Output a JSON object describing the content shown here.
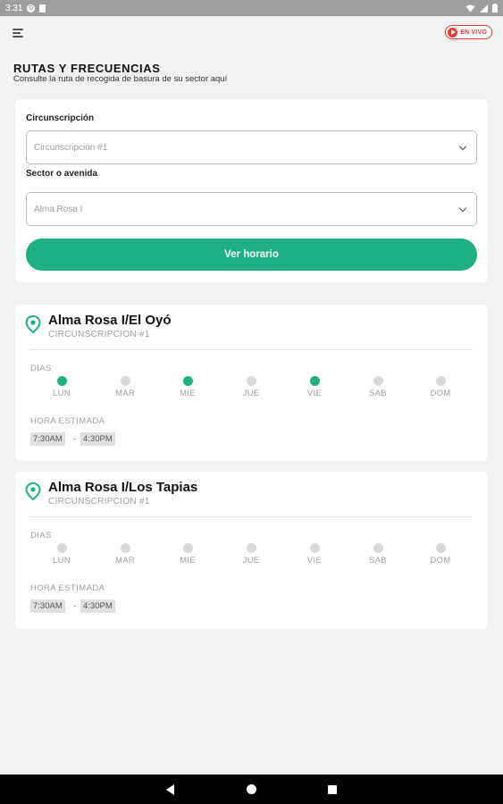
{
  "status_bar": {
    "time": "3:31",
    "icon_letter": "G"
  },
  "header": {
    "live_label": "EN VIVO"
  },
  "page": {
    "title": "RUTAS Y FRECUENCIAS",
    "subtitle": "Consulte la ruta de recogida de basura de su sector aquí"
  },
  "form": {
    "circ_label": "Circunscripción",
    "circ_value": "Circunscripción #1",
    "sector_label": "Sector o avenida",
    "sector_value": "Alma Rosa I",
    "button_label": "Ver horario"
  },
  "routes": [
    {
      "name": "Alma Rosa I/El Oyó",
      "circ": "CIRCUNSCRIPCION #1",
      "days_label": "DIAS",
      "days": [
        {
          "label": "LUN",
          "active": true
        },
        {
          "label": "MAR",
          "active": false
        },
        {
          "label": "MIE",
          "active": true
        },
        {
          "label": "JUE",
          "active": false
        },
        {
          "label": "VIE",
          "active": true
        },
        {
          "label": "SAB",
          "active": false
        },
        {
          "label": "DOM",
          "active": false
        }
      ],
      "hora_label": "HORA ESTIMADA",
      "start": "7:30AM",
      "separator": "-",
      "end": "4:30PM"
    },
    {
      "name": "Alma Rosa I/Los Tapias",
      "circ": "CIRCUNSCRIPCION #1",
      "days_label": "DIAS",
      "days": [
        {
          "label": "LUN",
          "active": false
        },
        {
          "label": "MAR",
          "active": false
        },
        {
          "label": "MIE",
          "active": false
        },
        {
          "label": "JUE",
          "active": false
        },
        {
          "label": "VIE",
          "active": false
        },
        {
          "label": "SAB",
          "active": false
        },
        {
          "label": "DOM",
          "active": false
        }
      ],
      "hora_label": "HORA ESTIMADA",
      "start": "7:30AM",
      "separator": "-",
      "end": "4:30PM"
    }
  ],
  "colors": {
    "accent": "#1eb083",
    "live": "#e53935"
  }
}
